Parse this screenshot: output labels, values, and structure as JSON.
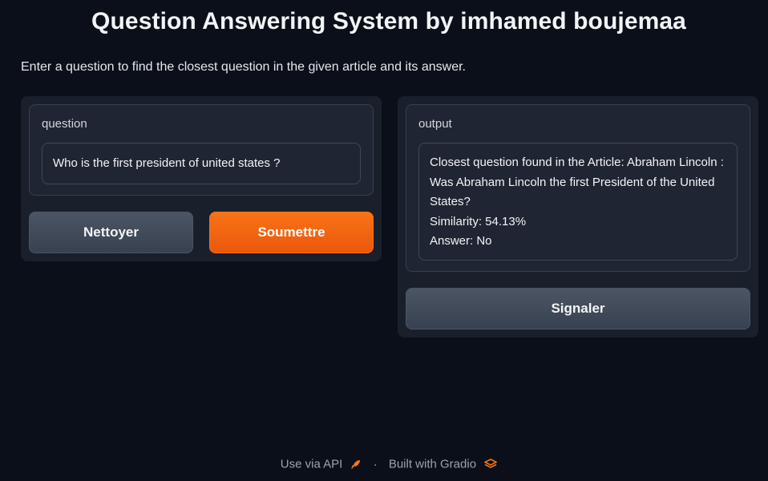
{
  "header": {
    "title": "Question Answering System by imhamed boujemaa",
    "description": "Enter a question to find the closest question in the given article and its answer."
  },
  "input": {
    "label": "question",
    "value": "Who is the first president of united states ?"
  },
  "output": {
    "label": "output",
    "lines": [
      "Closest question found in the Article: Abraham Lincoln : Was Abraham Lincoln the first President of the United States?",
      "Similarity: 54.13%",
      "Answer: No"
    ]
  },
  "buttons": {
    "clear": "Nettoyer",
    "submit": "Soumettre",
    "flag": "Signaler"
  },
  "footer": {
    "api_link": "Use via API",
    "separator": "·",
    "built_with": "Built with Gradio",
    "api_icon": "rocket-icon",
    "gradio_icon": "gradio-logo-icon"
  },
  "colors": {
    "background": "#0b0f19",
    "panel": "#1a1f2c",
    "primary": "#f97316",
    "secondary": "#4b5563"
  }
}
